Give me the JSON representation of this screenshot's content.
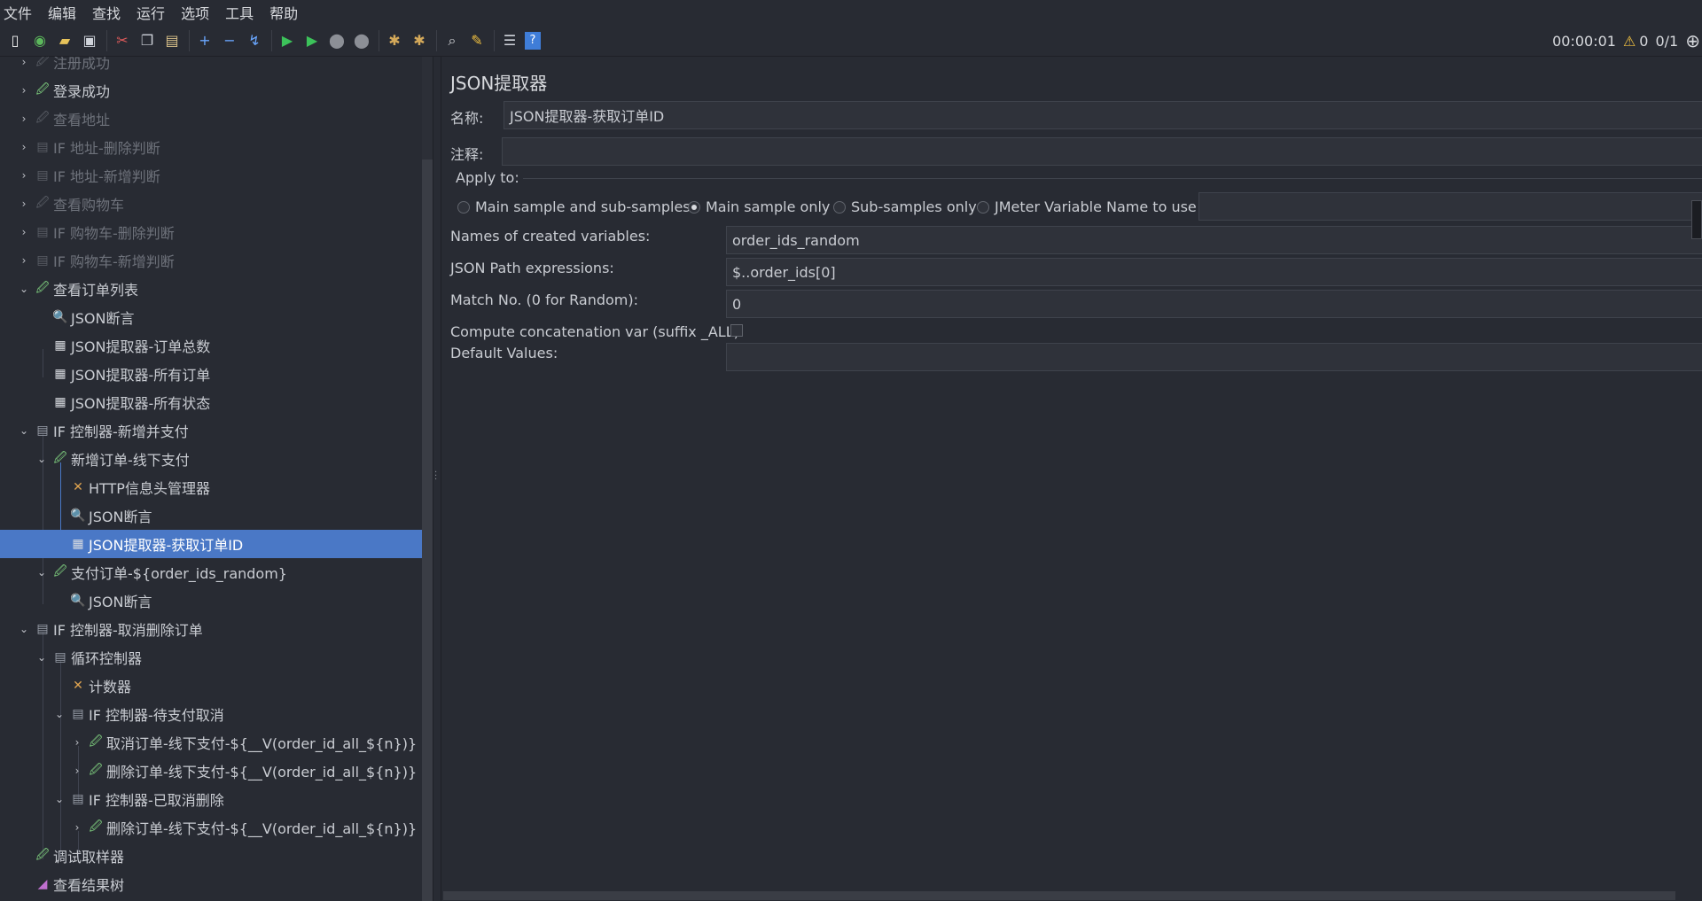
{
  "menu": [
    "文件",
    "编辑",
    "查找",
    "运行",
    "选项",
    "工具",
    "帮助"
  ],
  "toolbar": {
    "timer": "00:00:01",
    "warnings": "0",
    "threads": "0/1"
  },
  "tree": [
    {
      "label": "注册成功",
      "icon": "sampler-icon",
      "dim": true
    },
    {
      "label": "登录成功",
      "icon": "sampler-icon",
      "dim": false
    },
    {
      "label": "查看地址",
      "icon": "sampler-icon",
      "dim": true
    },
    {
      "label": "IF 地址-删除判断",
      "icon": "controller-icon",
      "dim": true
    },
    {
      "label": "IF 地址-新增判断",
      "icon": "controller-icon",
      "dim": true
    },
    {
      "label": "查看购物车",
      "icon": "sampler-icon",
      "dim": true
    },
    {
      "label": "IF 购物车-删除判断",
      "icon": "controller-icon",
      "dim": true
    },
    {
      "label": "IF 购物车-新增判断",
      "icon": "controller-icon",
      "dim": true
    },
    {
      "label": "查看订单列表",
      "icon": "sampler-icon",
      "dim": false
    },
    {
      "label": "JSON断言",
      "icon": "assertion-icon",
      "dim": false
    },
    {
      "label": "JSON提取器-订单总数",
      "icon": "extractor-icon",
      "dim": false
    },
    {
      "label": "JSON提取器-所有订单",
      "icon": "extractor-icon",
      "dim": false
    },
    {
      "label": "JSON提取器-所有状态",
      "icon": "extractor-icon",
      "dim": false
    },
    {
      "label": "IF 控制器-新增并支付",
      "icon": "controller-icon",
      "dim": false
    },
    {
      "label": "新增订单-线下支付",
      "icon": "sampler-icon",
      "dim": false
    },
    {
      "label": "HTTP信息头管理器",
      "icon": "config-icon",
      "dim": false
    },
    {
      "label": "JSON断言",
      "icon": "assertion-icon",
      "dim": false
    },
    {
      "label": "JSON提取器-获取订单ID",
      "icon": "extractor-icon",
      "dim": false
    },
    {
      "label": "支付订单-${order_ids_random}",
      "icon": "sampler-icon",
      "dim": false
    },
    {
      "label": "JSON断言",
      "icon": "assertion-icon",
      "dim": false
    },
    {
      "label": "IF 控制器-取消删除订单",
      "icon": "controller-icon",
      "dim": false
    },
    {
      "label": "循环控制器",
      "icon": "controller-icon",
      "dim": false
    },
    {
      "label": "计数器",
      "icon": "config-icon",
      "dim": false
    },
    {
      "label": "IF 控制器-待支付取消",
      "icon": "controller-icon",
      "dim": false
    },
    {
      "label": "取消订单-线下支付-${__V(order_id_all_${n})}",
      "icon": "sampler-icon",
      "dim": false
    },
    {
      "label": "删除订单-线下支付-${__V(order_id_all_${n})}",
      "icon": "sampler-icon",
      "dim": false
    },
    {
      "label": "IF 控制器-已取消删除",
      "icon": "controller-icon",
      "dim": false
    },
    {
      "label": "删除订单-线下支付-${__V(order_id_all_${n})}",
      "icon": "sampler-icon",
      "dim": false
    },
    {
      "label": "调试取样器",
      "icon": "sampler-icon",
      "dim": false
    },
    {
      "label": "查看结果树",
      "icon": "listener-icon",
      "dim": false
    }
  ],
  "panel": {
    "title": "JSON提取器",
    "name_label": "名称:",
    "name_value": "JSON提取器-获取订单ID",
    "comment_label": "注释:",
    "comment_value": "",
    "apply_to_label": "Apply to:",
    "apply_options": [
      "Main sample and sub-samples",
      "Main sample only",
      "Sub-samples only",
      "JMeter Variable Name to use"
    ],
    "apply_selected": "Main sample only",
    "jmeter_var_value": "",
    "var_names_label": "Names of created variables:",
    "var_names_value": "order_ids_random",
    "json_path_label": "JSON Path expressions:",
    "json_path_value": "$..order_ids[0]",
    "match_no_label": "Match No. (0 for Random):",
    "match_no_value": "0",
    "concat_label": "Compute concatenation var (suffix _ALL):",
    "concat_checked": false,
    "default_label": "Default Values:",
    "default_value": ""
  }
}
